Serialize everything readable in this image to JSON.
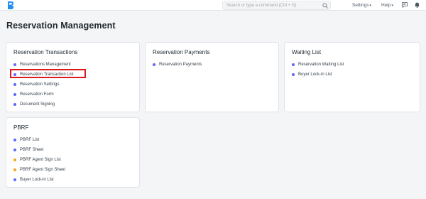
{
  "navbar": {
    "search_placeholder": "Search or type a command (Ctrl + G)",
    "settings_label": "Settings",
    "help_label": "Help",
    "brand_color": "#2490ef",
    "icons": [
      "app-logo-icon",
      "search-icon",
      "chat-icon",
      "bell-icon"
    ]
  },
  "page": {
    "title": "Reservation Management"
  },
  "cards": {
    "transactions": {
      "title": "Reservation Transactions",
      "items": [
        {
          "label": "Reservations Management",
          "color": "#5e64ff"
        },
        {
          "label": "Reservation Transaction List",
          "color": "#5e64ff",
          "highlighted": true
        },
        {
          "label": "Reservation Settings",
          "color": "#5e64ff"
        },
        {
          "label": "Reservation Form",
          "color": "#5e64ff"
        },
        {
          "label": "Document Signing",
          "color": "#5e64ff"
        }
      ]
    },
    "payments": {
      "title": "Reservation Payments",
      "items": [
        {
          "label": "Reservation Payments",
          "color": "#5e64ff"
        }
      ]
    },
    "waiting": {
      "title": "Waiting List",
      "items": [
        {
          "label": "Reservation Waiting List",
          "color": "#5e64ff"
        },
        {
          "label": "Buyer Lock-in List",
          "color": "#5e64ff"
        }
      ]
    },
    "pbrf": {
      "title": "PBRF",
      "items": [
        {
          "label": "PBRF List",
          "color": "#5e64ff"
        },
        {
          "label": "PBRF Sheet",
          "color": "#5e64ff"
        },
        {
          "label": "PBRF Agent Sign List",
          "color": "#f8a31a"
        },
        {
          "label": "PBRF Agent Sign Sheet",
          "color": "#f8a31a"
        },
        {
          "label": "Buyer Lock-in List",
          "color": "#5e64ff"
        }
      ]
    }
  }
}
